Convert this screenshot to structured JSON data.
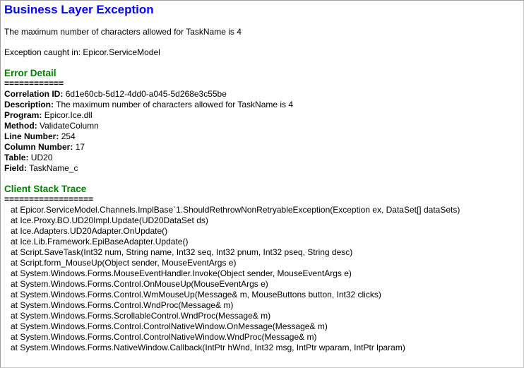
{
  "title": "Business Layer Exception",
  "message": "The maximum number of characters allowed for TaskName is 4",
  "exception_caught": "Exception caught in: Epicor.ServiceModel",
  "error_detail": {
    "heading": "Error Detail",
    "rule": "============",
    "fields": [
      {
        "label": "Correlation ID:",
        "value": "6d1e60cb-5d12-4dd0-a045-5d268e3c55be"
      },
      {
        "label": "Description:",
        "value": "The maximum number of characters allowed for TaskName is 4"
      },
      {
        "label": "Program:",
        "value": "Epicor.Ice.dll"
      },
      {
        "label": "Method:",
        "value": "ValidateColumn"
      },
      {
        "label": "Line Number:",
        "value": "254"
      },
      {
        "label": "Column Number:",
        "value": "17"
      },
      {
        "label": "Table:",
        "value": "UD20"
      },
      {
        "label": "Field:",
        "value": "TaskName_c"
      }
    ]
  },
  "stack_trace": {
    "heading": "Client Stack Trace",
    "rule": "==================",
    "lines": [
      "at Epicor.ServiceModel.Channels.ImplBase`1.ShouldRethrowNonRetryableException(Exception ex, DataSet[] dataSets)",
      "at Ice.Proxy.BO.UD20Impl.Update(UD20DataSet ds)",
      "at Ice.Adapters.UD20Adapter.OnUpdate()",
      "at Ice.Lib.Framework.EpiBaseAdapter.Update()",
      "at Script.SaveTask(Int32 num, String name, Int32 seq, Int32 pnum, Int32 pseq, String desc)",
      "at Script.form_MouseUp(Object sender, MouseEventArgs e)",
      "at System.Windows.Forms.MouseEventHandler.Invoke(Object sender, MouseEventArgs e)",
      "at System.Windows.Forms.Control.OnMouseUp(MouseEventArgs e)",
      "at System.Windows.Forms.Control.WmMouseUp(Message& m, MouseButtons button, Int32 clicks)",
      "at System.Windows.Forms.Control.WndProc(Message& m)",
      "at System.Windows.Forms.ScrollableControl.WndProc(Message& m)",
      "at System.Windows.Forms.Control.ControlNativeWindow.OnMessage(Message& m)",
      "at System.Windows.Forms.Control.ControlNativeWindow.WndProc(Message& m)",
      "at System.Windows.Forms.NativeWindow.Callback(IntPtr hWnd, Int32 msg, IntPtr wparam, IntPtr lparam)"
    ]
  }
}
